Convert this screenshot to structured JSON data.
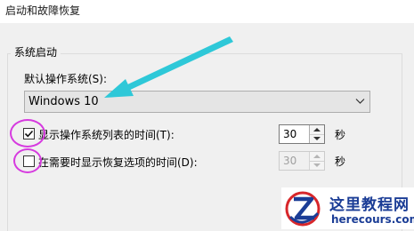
{
  "window": {
    "title": "启动和故障恢复"
  },
  "system_startup": {
    "group_label": "系统启动",
    "default_os_label": "默认操作系统(S):",
    "default_os_value": "Windows 10",
    "show_os_list": {
      "label": "显示操作系统列表的时间(T):",
      "checked": true,
      "value": "30",
      "unit": "秒"
    },
    "show_recovery": {
      "label": "在需要时显示恢复选项的时间(D):",
      "checked": false,
      "value": "30",
      "unit": "秒"
    }
  },
  "watermark": {
    "title": "这里教程网",
    "url": "herecours.com"
  },
  "colors": {
    "annotation_arrow": "#2ec8d8",
    "annotation_ring": "#d63adf",
    "watermark_text": "#1b3d96",
    "watermark_logo_red": "#d8262a"
  }
}
